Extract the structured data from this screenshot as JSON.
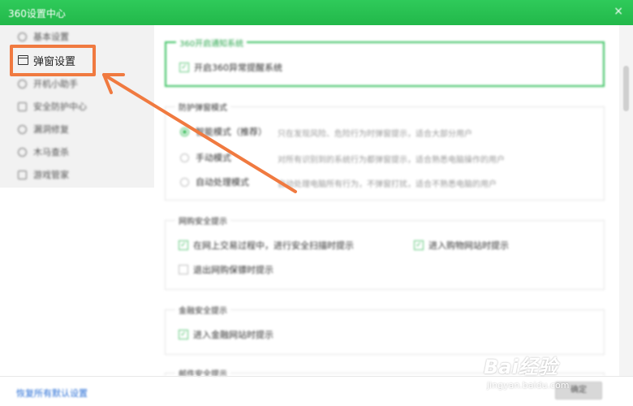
{
  "window": {
    "title": "360设置中心",
    "close_glyph": "×",
    "accent_color": "#22b84a"
  },
  "sidebar": {
    "items": [
      {
        "label": "基本设置",
        "icon": "gear-icon"
      },
      {
        "label": "弹窗设置",
        "icon": "window-icon",
        "active": true
      },
      {
        "label": "开机小助手",
        "icon": "clock-icon"
      },
      {
        "label": "安全防护中心",
        "icon": "shield-icon"
      },
      {
        "label": "漏洞修复",
        "icon": "patch-icon"
      },
      {
        "label": "木马查杀",
        "icon": "bug-icon"
      },
      {
        "label": "游戏管家",
        "icon": "gamepad-icon"
      }
    ],
    "highlight_color": "#f07a40"
  },
  "footer": {
    "restore_link": "恢复所有默认设置",
    "ok_button": "确定"
  },
  "content": {
    "section_notify": {
      "title": "360开启通知系统",
      "checkbox": {
        "label": "开启360异常提醒系统",
        "checked": true
      }
    },
    "section_mode": {
      "title": "防护弹窗模式",
      "options": [
        {
          "label": "智能模式（推荐）",
          "desc": "只在发现风险、危险行为时弹窗提示，适合大部分用户",
          "selected": true
        },
        {
          "label": "手动模式",
          "desc": "对所有识别到的系统行为都弹窗提示，适合熟悉电脑操作的用户",
          "selected": false
        },
        {
          "label": "自动处理模式",
          "desc": "自动处理电脑所有行为，不弹窗打扰，适合不熟悉电脑的用户",
          "selected": false
        }
      ]
    },
    "section_shopping": {
      "title": "网购安全提示",
      "checkboxes": [
        {
          "label": "在网上交易过程中，进行安全扫描时提示",
          "checked": true
        },
        {
          "label": "进入购物网站时提示",
          "checked": true
        },
        {
          "label": "退出网购保镖时提示",
          "checked": false
        }
      ]
    },
    "section_finance": {
      "title": "金融安全提示",
      "checkbox": {
        "label": "进入金融网站时提示",
        "checked": true
      }
    },
    "section_next": {
      "title": "邮件安全提示"
    }
  },
  "watermark": {
    "brand": "Bai经验",
    "url": "jingyan.baidu.com"
  }
}
